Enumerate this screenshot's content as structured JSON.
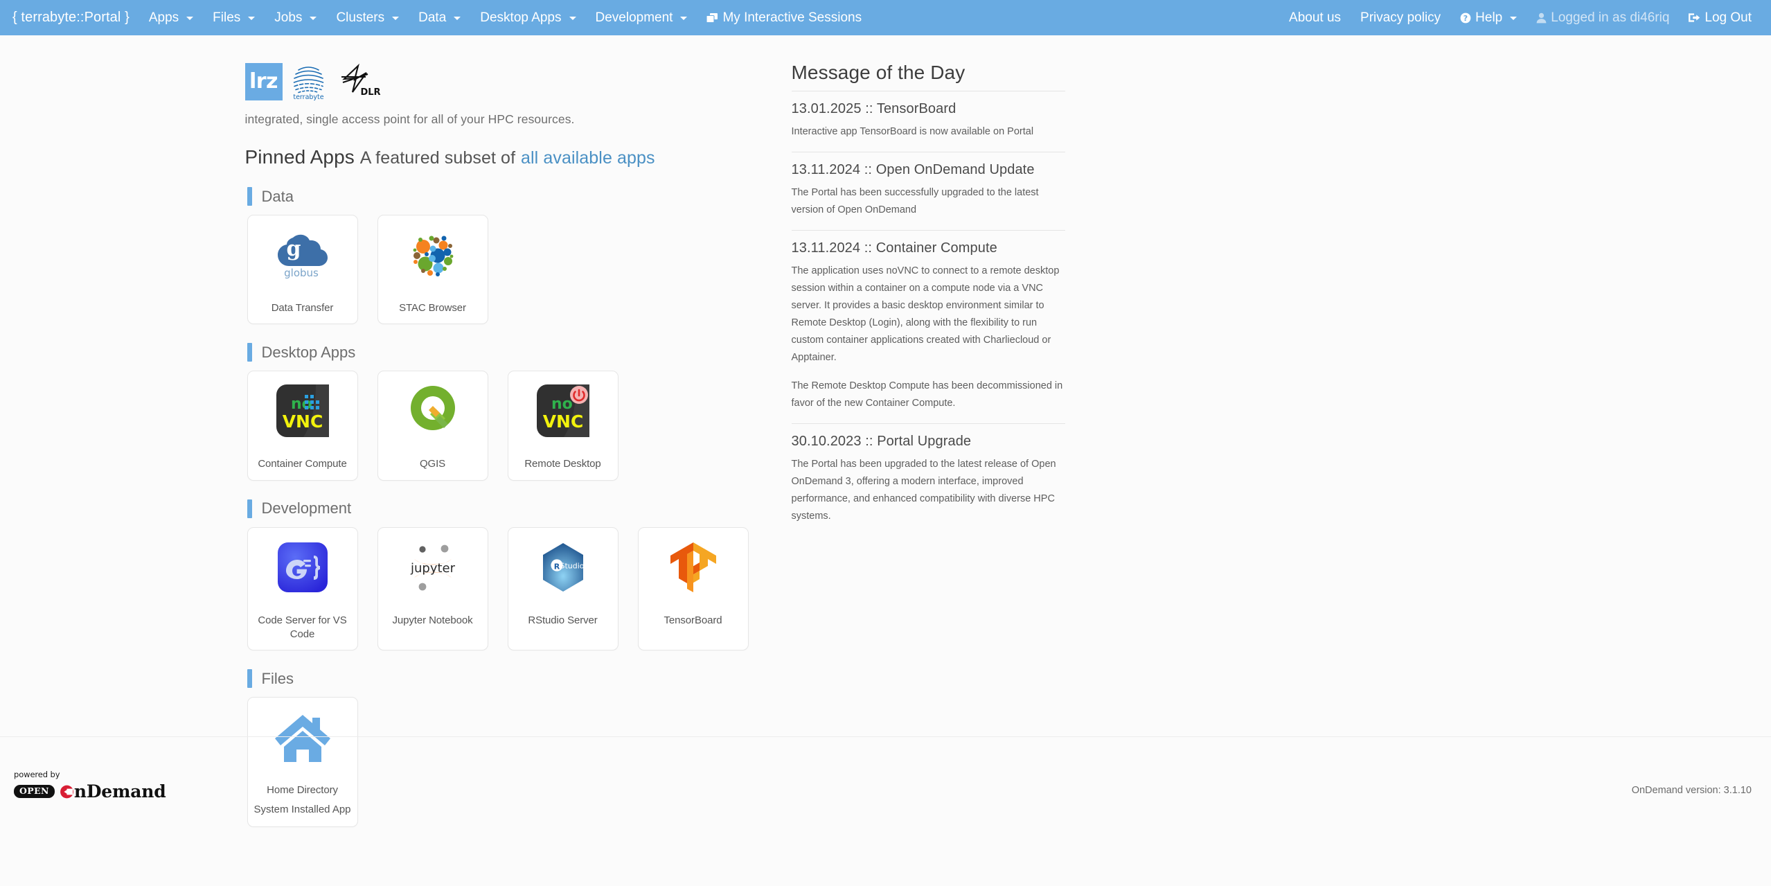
{
  "navbar": {
    "brand": "{ terrabyte::Portal }",
    "left_items": [
      {
        "label": "Apps",
        "caret": true,
        "icon": null
      },
      {
        "label": "Files",
        "caret": true,
        "icon": null
      },
      {
        "label": "Jobs",
        "caret": true,
        "icon": null
      },
      {
        "label": "Clusters",
        "caret": true,
        "icon": null
      },
      {
        "label": "Data",
        "caret": true,
        "icon": null
      },
      {
        "label": "Desktop Apps",
        "caret": true,
        "icon": null
      },
      {
        "label": "Development",
        "caret": true,
        "icon": null
      },
      {
        "label": "My Interactive Sessions",
        "caret": false,
        "icon": "windows-stack-icon"
      }
    ],
    "right_items": [
      {
        "label": "About us",
        "caret": false,
        "icon": null
      },
      {
        "label": "Privacy policy",
        "caret": false,
        "icon": null
      },
      {
        "label": "Help",
        "caret": true,
        "icon": "question-circle-icon"
      },
      {
        "label": "Logged in as di46riq",
        "caret": false,
        "icon": "user-icon",
        "dim": true
      },
      {
        "label": "Log Out",
        "caret": false,
        "icon": "logout-icon"
      }
    ]
  },
  "branding": {
    "lrz_text": "lrz",
    "terrabyte_text": "terrabyte",
    "dlr_text": "DLR",
    "tagline": "integrated, single access point for all of your HPC resources."
  },
  "pinned": {
    "heading": "Pinned Apps",
    "subheading": "A featured subset of",
    "link": "all available apps",
    "categories": [
      {
        "label": "Data",
        "apps": [
          {
            "title": "Data Transfer",
            "subtitle": "",
            "icon": "globus-icon"
          },
          {
            "title": "STAC Browser",
            "subtitle": "",
            "icon": "stac-bubbles-icon"
          }
        ]
      },
      {
        "label": "Desktop Apps",
        "apps": [
          {
            "title": "Container Compute",
            "subtitle": "",
            "icon": "novnc-icon"
          },
          {
            "title": "QGIS",
            "subtitle": "",
            "icon": "qgis-icon"
          },
          {
            "title": "Remote Desktop",
            "subtitle": "",
            "icon": "novnc-power-icon"
          }
        ]
      },
      {
        "label": "Development",
        "apps": [
          {
            "title": "Code Server for VS Code",
            "subtitle": "",
            "icon": "code-server-icon"
          },
          {
            "title": "Jupyter Notebook",
            "subtitle": "",
            "icon": "jupyter-icon"
          },
          {
            "title": "RStudio Server",
            "subtitle": "",
            "icon": "rstudio-icon"
          },
          {
            "title": "TensorBoard",
            "subtitle": "",
            "icon": "tensorflow-icon"
          }
        ]
      },
      {
        "label": "Files",
        "apps": [
          {
            "title": "Home Directory",
            "subtitle": "System Installed App",
            "icon": "home-icon"
          }
        ]
      }
    ]
  },
  "motd": {
    "title": "Message of the Day",
    "items": [
      {
        "heading": "13.01.2025 :: TensorBoard",
        "paragraphs": [
          "Interactive app TensorBoard is now available on Portal"
        ]
      },
      {
        "heading": "13.11.2024 :: Open OnDemand Update",
        "paragraphs": [
          "The Portal has been successfully upgraded to the latest version of Open OnDemand"
        ]
      },
      {
        "heading": "13.11.2024 :: Container Compute",
        "paragraphs": [
          "The application uses noVNC to connect to a remote desktop session within a container on a compute node via a VNC server. It provides a basic desktop environment similar to Remote Desktop (Login), along with the flexibility to run custom container applications created with Charliecloud or Apptainer.",
          "The Remote Desktop Compute has been decommissioned in favor of the new Container Compute."
        ]
      },
      {
        "heading": "30.10.2023 :: Portal Upgrade",
        "paragraphs": [
          "The Portal has been upgraded to the latest release of Open OnDemand 3, offering a modern interface, improved performance, and enhanced compatibility with diverse HPC systems."
        ]
      }
    ]
  },
  "footer": {
    "powered_by": "powered by",
    "open_pill": "OPEN",
    "ondemand_word": "nDemand",
    "version": "OnDemand version: 3.1.10"
  },
  "colors": {
    "navbar": "#69abe2",
    "accent": "#69abe2",
    "link": "#4a90c4",
    "background": "#fbfbfb"
  }
}
